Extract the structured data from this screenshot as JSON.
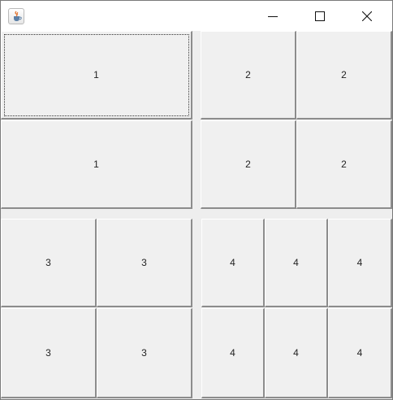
{
  "window": {
    "icon": "java-cup-icon",
    "controls": {
      "minimize": "minimize-icon",
      "maximize": "maximize-icon",
      "close": "close-icon"
    }
  },
  "panels": {
    "panel1": [
      "1",
      "1"
    ],
    "panel2": [
      "2",
      "2",
      "2",
      "2"
    ],
    "panel3": [
      "3",
      "3",
      "3",
      "3"
    ],
    "panel4": [
      "4",
      "4",
      "4",
      "4",
      "4",
      "4"
    ]
  }
}
